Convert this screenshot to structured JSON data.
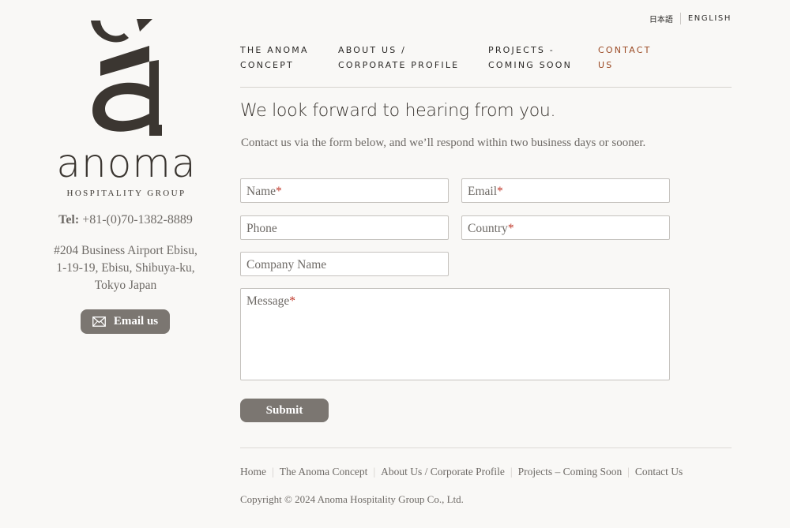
{
  "brand": {
    "name": "anoma",
    "subtitle": "HOSPITALITY GROUP",
    "color": "#3b3631"
  },
  "contact": {
    "tel_label": "Tel:",
    "tel_value": "+81-(0)70-1382-8889",
    "address_lines": [
      "#204 Business Airport Ebisu,",
      "1-19-19, Ebisu, Shibuya-ku,",
      "Tokyo Japan"
    ],
    "email_button": "Email us"
  },
  "language": {
    "japanese": "日本語",
    "english": "ENGLISH"
  },
  "nav": {
    "items": [
      {
        "line1": "THE ANOMA",
        "line2": "CONCEPT"
      },
      {
        "line1": "ABOUT US /",
        "line2": "CORPORATE PROFILE"
      },
      {
        "line1": "PROJECTS -",
        "line2": "COMING SOON"
      },
      {
        "line1": "CONTACT",
        "line2": "US"
      }
    ],
    "active_color": "#9b4a24"
  },
  "main": {
    "heading": "We look forward to hearing from you.",
    "intro": "Contact us via the form below, and we’ll respond within two business days or sooner."
  },
  "form": {
    "name_placeholder": "Name",
    "email_placeholder": "Email",
    "phone_placeholder": "Phone",
    "country_placeholder": "Country",
    "company_placeholder": "Company Name",
    "message_placeholder": "Message",
    "required_mark": "*",
    "submit_label": "Submit"
  },
  "footer": {
    "links": [
      "Home",
      "The Anoma Concept",
      "About Us / Corporate Profile",
      "Projects – Coming Soon",
      "Contact Us"
    ],
    "copyright": "Copyright © 2024 Anoma Hospitality Group Co., Ltd."
  }
}
